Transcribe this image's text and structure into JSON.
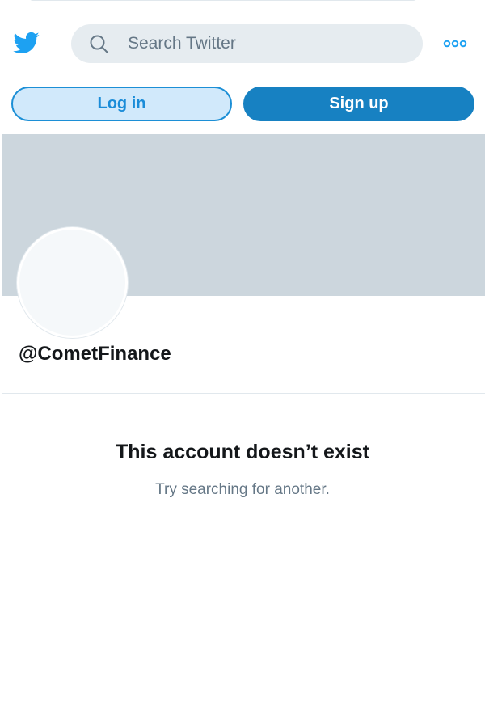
{
  "header": {
    "logo_icon": "twitter-bird-icon",
    "search": {
      "placeholder": "Search Twitter",
      "value": "",
      "icon": "search-icon"
    },
    "more_icon": "more-options-icon"
  },
  "auth": {
    "login_label": "Log in",
    "signup_label": "Sign up"
  },
  "profile": {
    "handle": "@CometFinance"
  },
  "empty_state": {
    "title": "This account doesn’t exist",
    "subtitle": "Try searching for another."
  },
  "colors": {
    "brand": "#1da1f2",
    "signup_bg": "#1781c2",
    "login_bg": "#d1e9fb",
    "banner": "#ccd6dd",
    "text_primary": "#14171a",
    "text_secondary": "#657786"
  }
}
